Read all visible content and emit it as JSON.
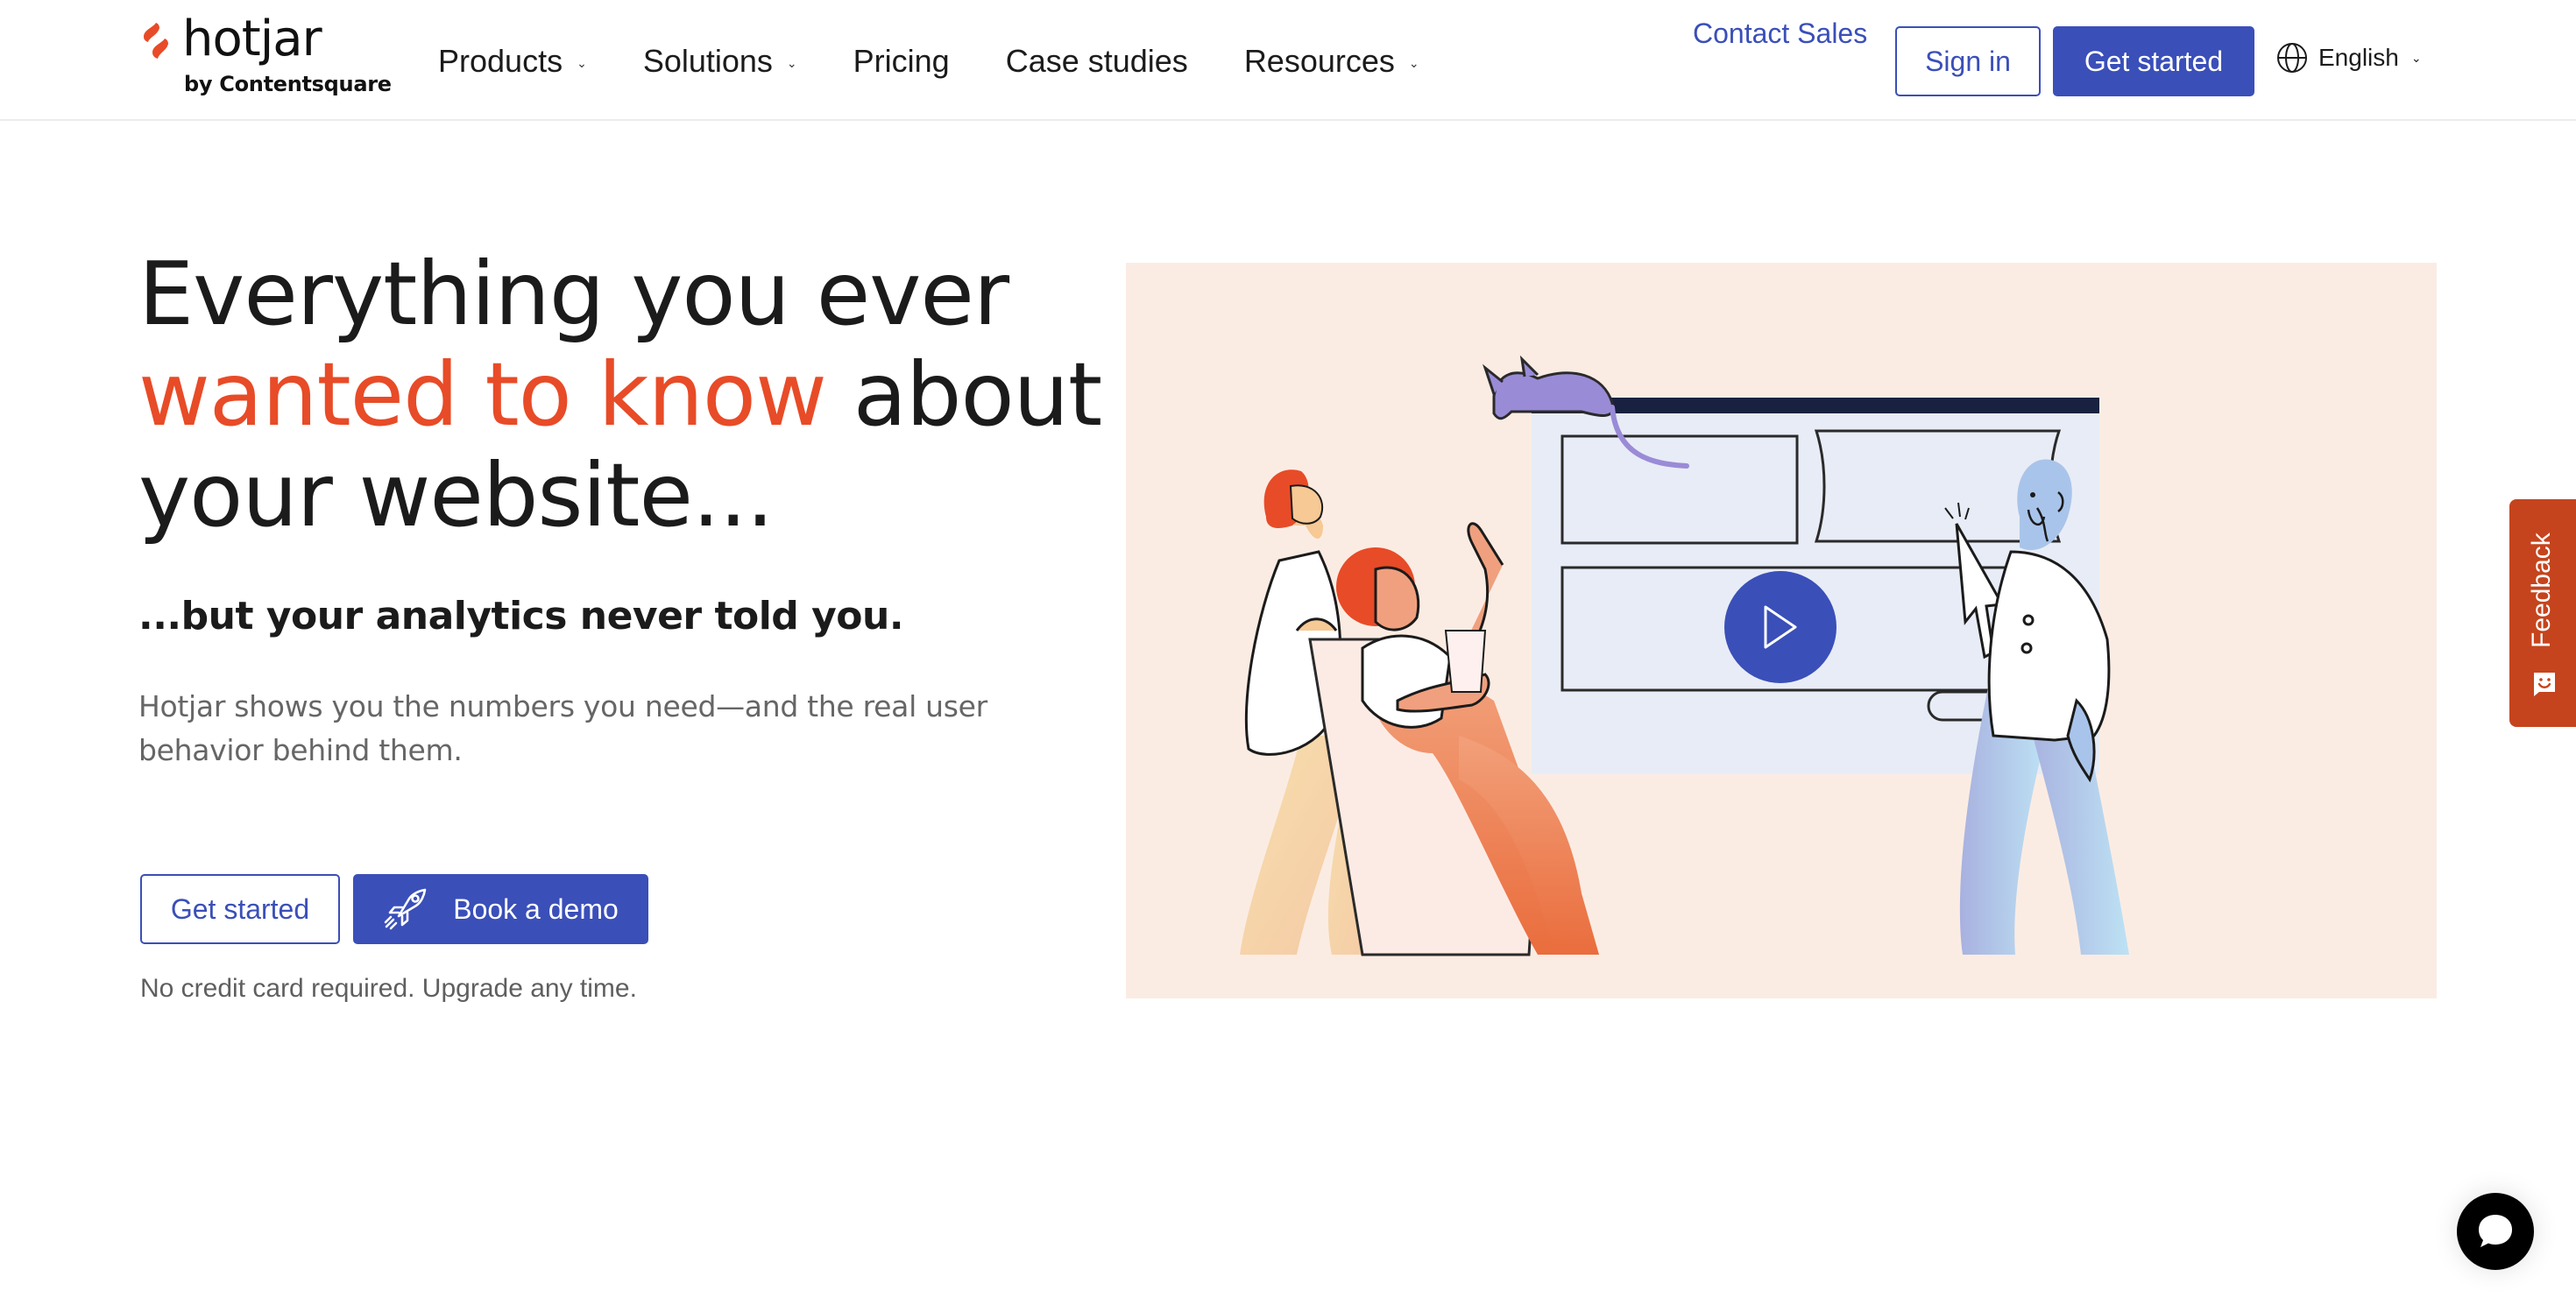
{
  "brand": {
    "name": "hotjar",
    "byline": "by Contentsquare",
    "accent_color": "#e84b27",
    "primary_color": "#3a4fb8"
  },
  "nav": {
    "menu": [
      {
        "label": "Products",
        "has_dropdown": true
      },
      {
        "label": "Solutions",
        "has_dropdown": true
      },
      {
        "label": "Pricing",
        "has_dropdown": false
      },
      {
        "label": "Case studies",
        "has_dropdown": false
      },
      {
        "label": "Resources",
        "has_dropdown": true
      }
    ],
    "contact_sales": "Contact Sales",
    "sign_in": "Sign in",
    "get_started": "Get started",
    "language": "English"
  },
  "hero": {
    "headline_part1": "Everything you ever",
    "headline_accent": "wanted to know",
    "headline_part2": "about your website...",
    "subheading": "...but your analytics never told you.",
    "body": "Hotjar shows you the numbers you need—and the real user behavior behind them.",
    "cta_primary": "Get started",
    "cta_demo": "Book a demo",
    "note": "No credit card required. Upgrade any time."
  },
  "video": {
    "play_icon": "play-icon"
  },
  "feedback_tab": {
    "label": "Feedback",
    "icon": "smiley-speech-icon"
  },
  "chat": {
    "icon": "chat-bubble-icon"
  }
}
